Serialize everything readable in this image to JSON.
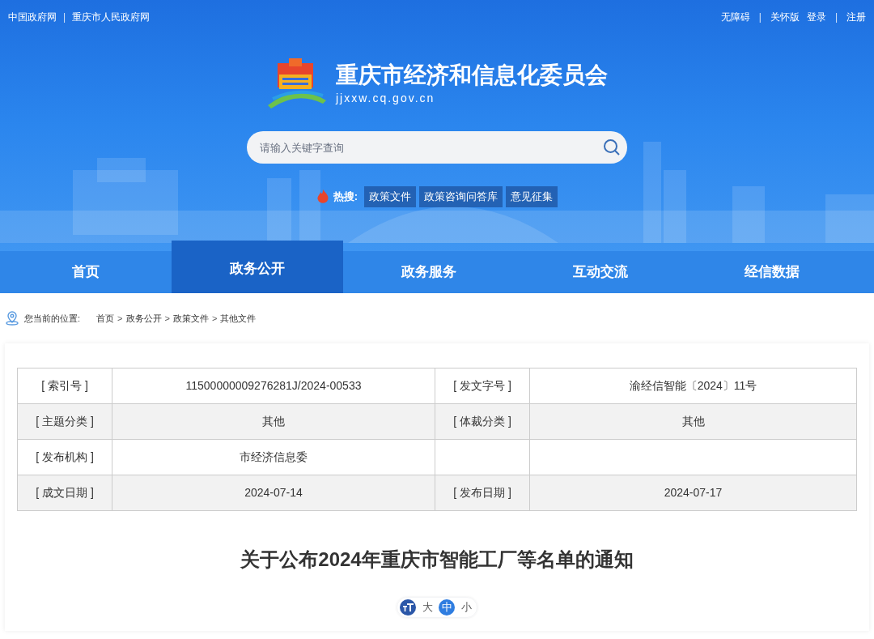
{
  "top_bar": {
    "left": [
      {
        "kind": "link",
        "text": "中国政府网"
      },
      {
        "kind": "sep",
        "text": "|"
      },
      {
        "kind": "link",
        "text": "重庆市人民政府网"
      }
    ],
    "right": [
      {
        "kind": "link",
        "text": "无障碍"
      },
      {
        "kind": "sep",
        "text": "|"
      },
      {
        "kind": "link",
        "text": "关怀版"
      },
      {
        "kind": "link",
        "text": "登录"
      },
      {
        "kind": "sep",
        "text": "|"
      },
      {
        "kind": "link",
        "text": "注册"
      }
    ]
  },
  "site": {
    "title": "重庆市经济和信息化委员会",
    "domain": "jjxxw.cq.gov.cn"
  },
  "search": {
    "placeholder": "请输入关键字查询"
  },
  "hot_search": {
    "label": "热搜:",
    "tags": [
      "政策文件",
      "政策咨询问答库",
      "意见征集"
    ]
  },
  "nav": [
    {
      "label": "首页",
      "selected": false
    },
    {
      "label": "政务公开",
      "selected": true
    },
    {
      "label": "政务服务",
      "selected": false
    },
    {
      "label": "互动交流",
      "selected": false
    },
    {
      "label": "经信数据",
      "selected": false
    }
  ],
  "breadcrumb": {
    "label": "您当前的位置:",
    "items": [
      {
        "kind": "link",
        "text": "首页"
      },
      {
        "kind": "sep",
        "text": ">"
      },
      {
        "kind": "link",
        "text": "政务公开"
      },
      {
        "kind": "sep",
        "text": ">"
      },
      {
        "kind": "link",
        "text": "政策文件"
      },
      {
        "kind": "sep",
        "text": ">"
      },
      {
        "kind": "link",
        "text": "其他文件"
      }
    ]
  },
  "info_table": [
    {
      "label": "[ 索引号 ]",
      "value": "11500000009276281J/2024-00533",
      "label2": "[ 发文字号 ]",
      "value2": "渝经信智能〔2024〕11号"
    },
    {
      "label": "[ 主题分类 ]",
      "value": "其他",
      "label2": "[ 体裁分类 ]",
      "value2": "其他"
    },
    {
      "label": "[ 发布机构 ]",
      "value": "市经济信息委"
    },
    {
      "label": "[ 成文日期 ]",
      "value": "2024-07-14",
      "label2": "[ 发布日期 ]",
      "value2": "2024-07-17"
    }
  ],
  "article": {
    "title": "关于公布2024年重庆市智能工厂等名单的通知"
  },
  "font_size": [
    {
      "label": "大",
      "selected": false
    },
    {
      "label": "中",
      "selected": true
    },
    {
      "label": "小",
      "selected": false
    }
  ]
}
